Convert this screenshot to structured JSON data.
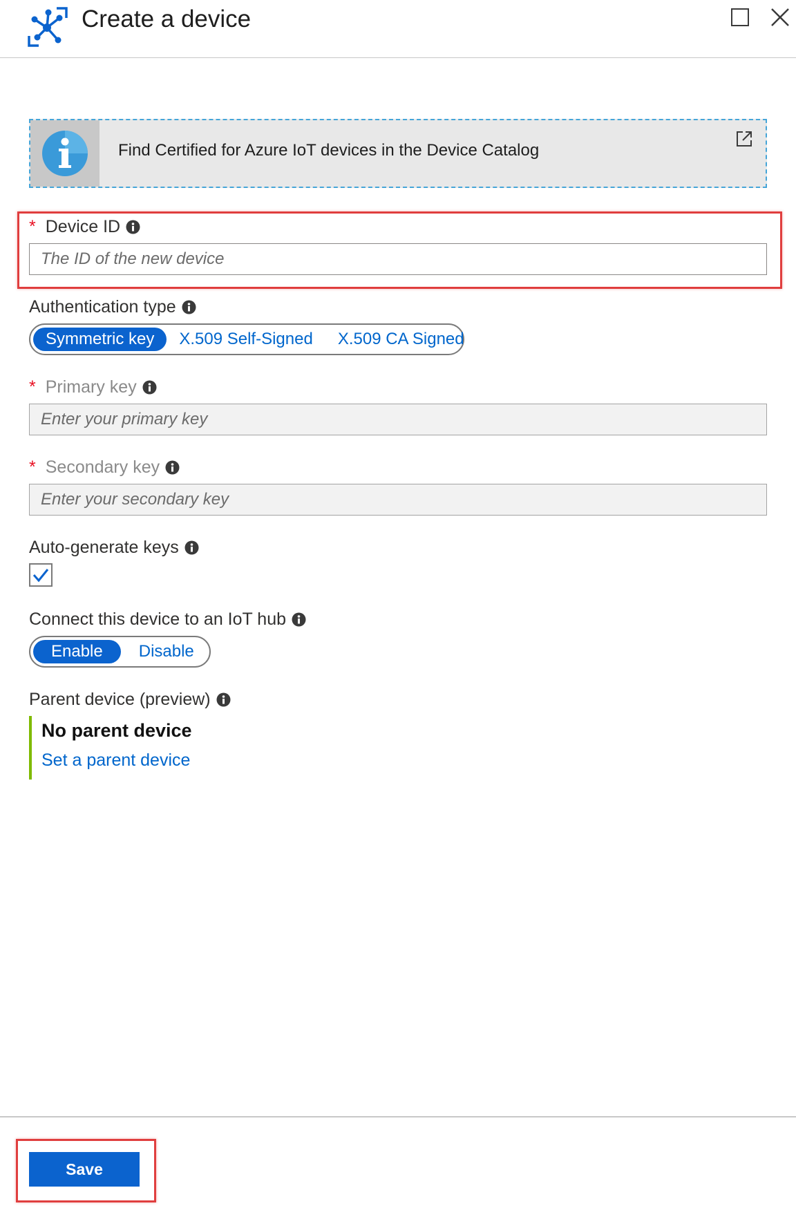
{
  "window": {
    "title": "Create a device",
    "icons": [
      "iot-device-icon",
      "maximize-icon",
      "close-icon"
    ]
  },
  "banner": {
    "text": "Find Certified for Azure IoT devices in the Device Catalog",
    "icon": "info-icon",
    "link_icon": "external-link-icon"
  },
  "device_id": {
    "label": "Device ID",
    "required": "*",
    "placeholder": "The ID of the new device",
    "value": ""
  },
  "auth_type": {
    "label": "Authentication type",
    "options": [
      "Symmetric key",
      "X.509 Self-Signed",
      "X.509 CA Signed"
    ],
    "selected": "Symmetric key"
  },
  "primary_key": {
    "label": "Primary key",
    "required": "*",
    "placeholder": "Enter your primary key"
  },
  "secondary_key": {
    "label": "Secondary key",
    "required": "*",
    "placeholder": "Enter your secondary key"
  },
  "auto_generate": {
    "label": "Auto-generate keys",
    "checked": true
  },
  "connect_hub": {
    "label": "Connect this device to an IoT hub",
    "options": [
      "Enable",
      "Disable"
    ],
    "selected": "Enable"
  },
  "parent_device": {
    "label": "Parent device (preview)",
    "value": "No parent device",
    "link": "Set a parent device"
  },
  "footer": {
    "save_label": "Save"
  },
  "colors": {
    "accent": "#0b63ce",
    "link": "#0066cc",
    "required": "#e81123",
    "highlight": "#e03e3e",
    "banner_border": "#45a5d8",
    "parent_bar": "#7fba00"
  }
}
